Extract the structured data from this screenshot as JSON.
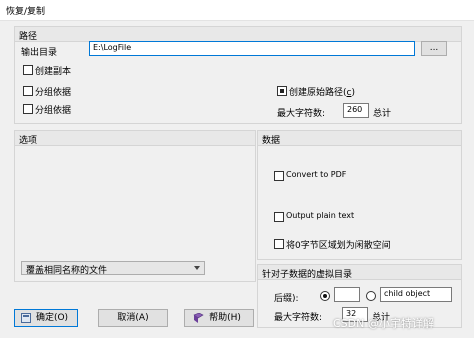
{
  "window": {
    "title": "恢复/复制"
  },
  "path_panel": {
    "header": "路径",
    "output_dir_label": "输出目录",
    "output_dir_value": "E:\\LogFile",
    "browse_label": "...",
    "create_copy_label": "创建副本",
    "group_by_1_label": "分组依据",
    "group_by_2_label": "分组依据",
    "create_original_path_label": "创建原始路径(",
    "create_original_path_hotkey": "c",
    "create_original_path_suffix": ")",
    "max_chars_label": "最大字符数:",
    "max_chars_value": "260",
    "max_chars_unit": "总计"
  },
  "options_panel": {
    "header": "选项",
    "overwrite_select_value": "覆盖相同名称的文件"
  },
  "data_panel": {
    "header": "数据",
    "convert_pdf_label": "Convert to PDF",
    "output_plain_text_label": "Output plain text",
    "zero_byte_label": "将0字节区域划为闲散空间"
  },
  "virtual_panel": {
    "header": "针对子数据的虚拟目录",
    "suffix_label": "后缀):",
    "child_object_value": "child object",
    "max_chars_label": "最大字符数:",
    "max_chars_value": "32",
    "max_chars_unit": "总计"
  },
  "buttons": {
    "ok_label": "确定(O)",
    "cancel_label": "取消(A)",
    "help_label": "帮助(H)"
  },
  "watermark": "CSDN @小宇特详解",
  "colors": {
    "focus_border": "#0078d7",
    "panel_header_bg": "#e8e8e8",
    "window_bg": "#f0f0f0"
  }
}
